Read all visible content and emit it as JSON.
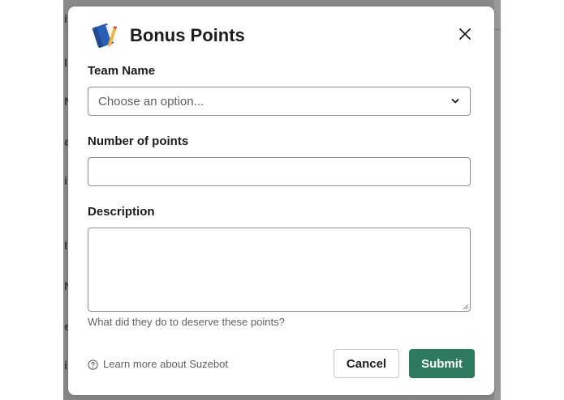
{
  "modal": {
    "title": "Bonus Points",
    "icon": "notebook-icon",
    "close_icon": "close-icon"
  },
  "fields": {
    "team_name": {
      "label": "Team Name",
      "placeholder": "Choose an option..."
    },
    "points": {
      "label": "Number of points",
      "value": ""
    },
    "description": {
      "label": "Description",
      "value": "",
      "hint": "What did they do to deserve these points?"
    }
  },
  "footer": {
    "learn_more": "Learn more about Suzebot",
    "cancel_label": "Cancel",
    "submit_label": "Submit"
  },
  "colors": {
    "primary": "#2e7a5c",
    "text": "#1d1c1d",
    "muted": "#616061",
    "backdrop": "#8a8a8a"
  }
}
